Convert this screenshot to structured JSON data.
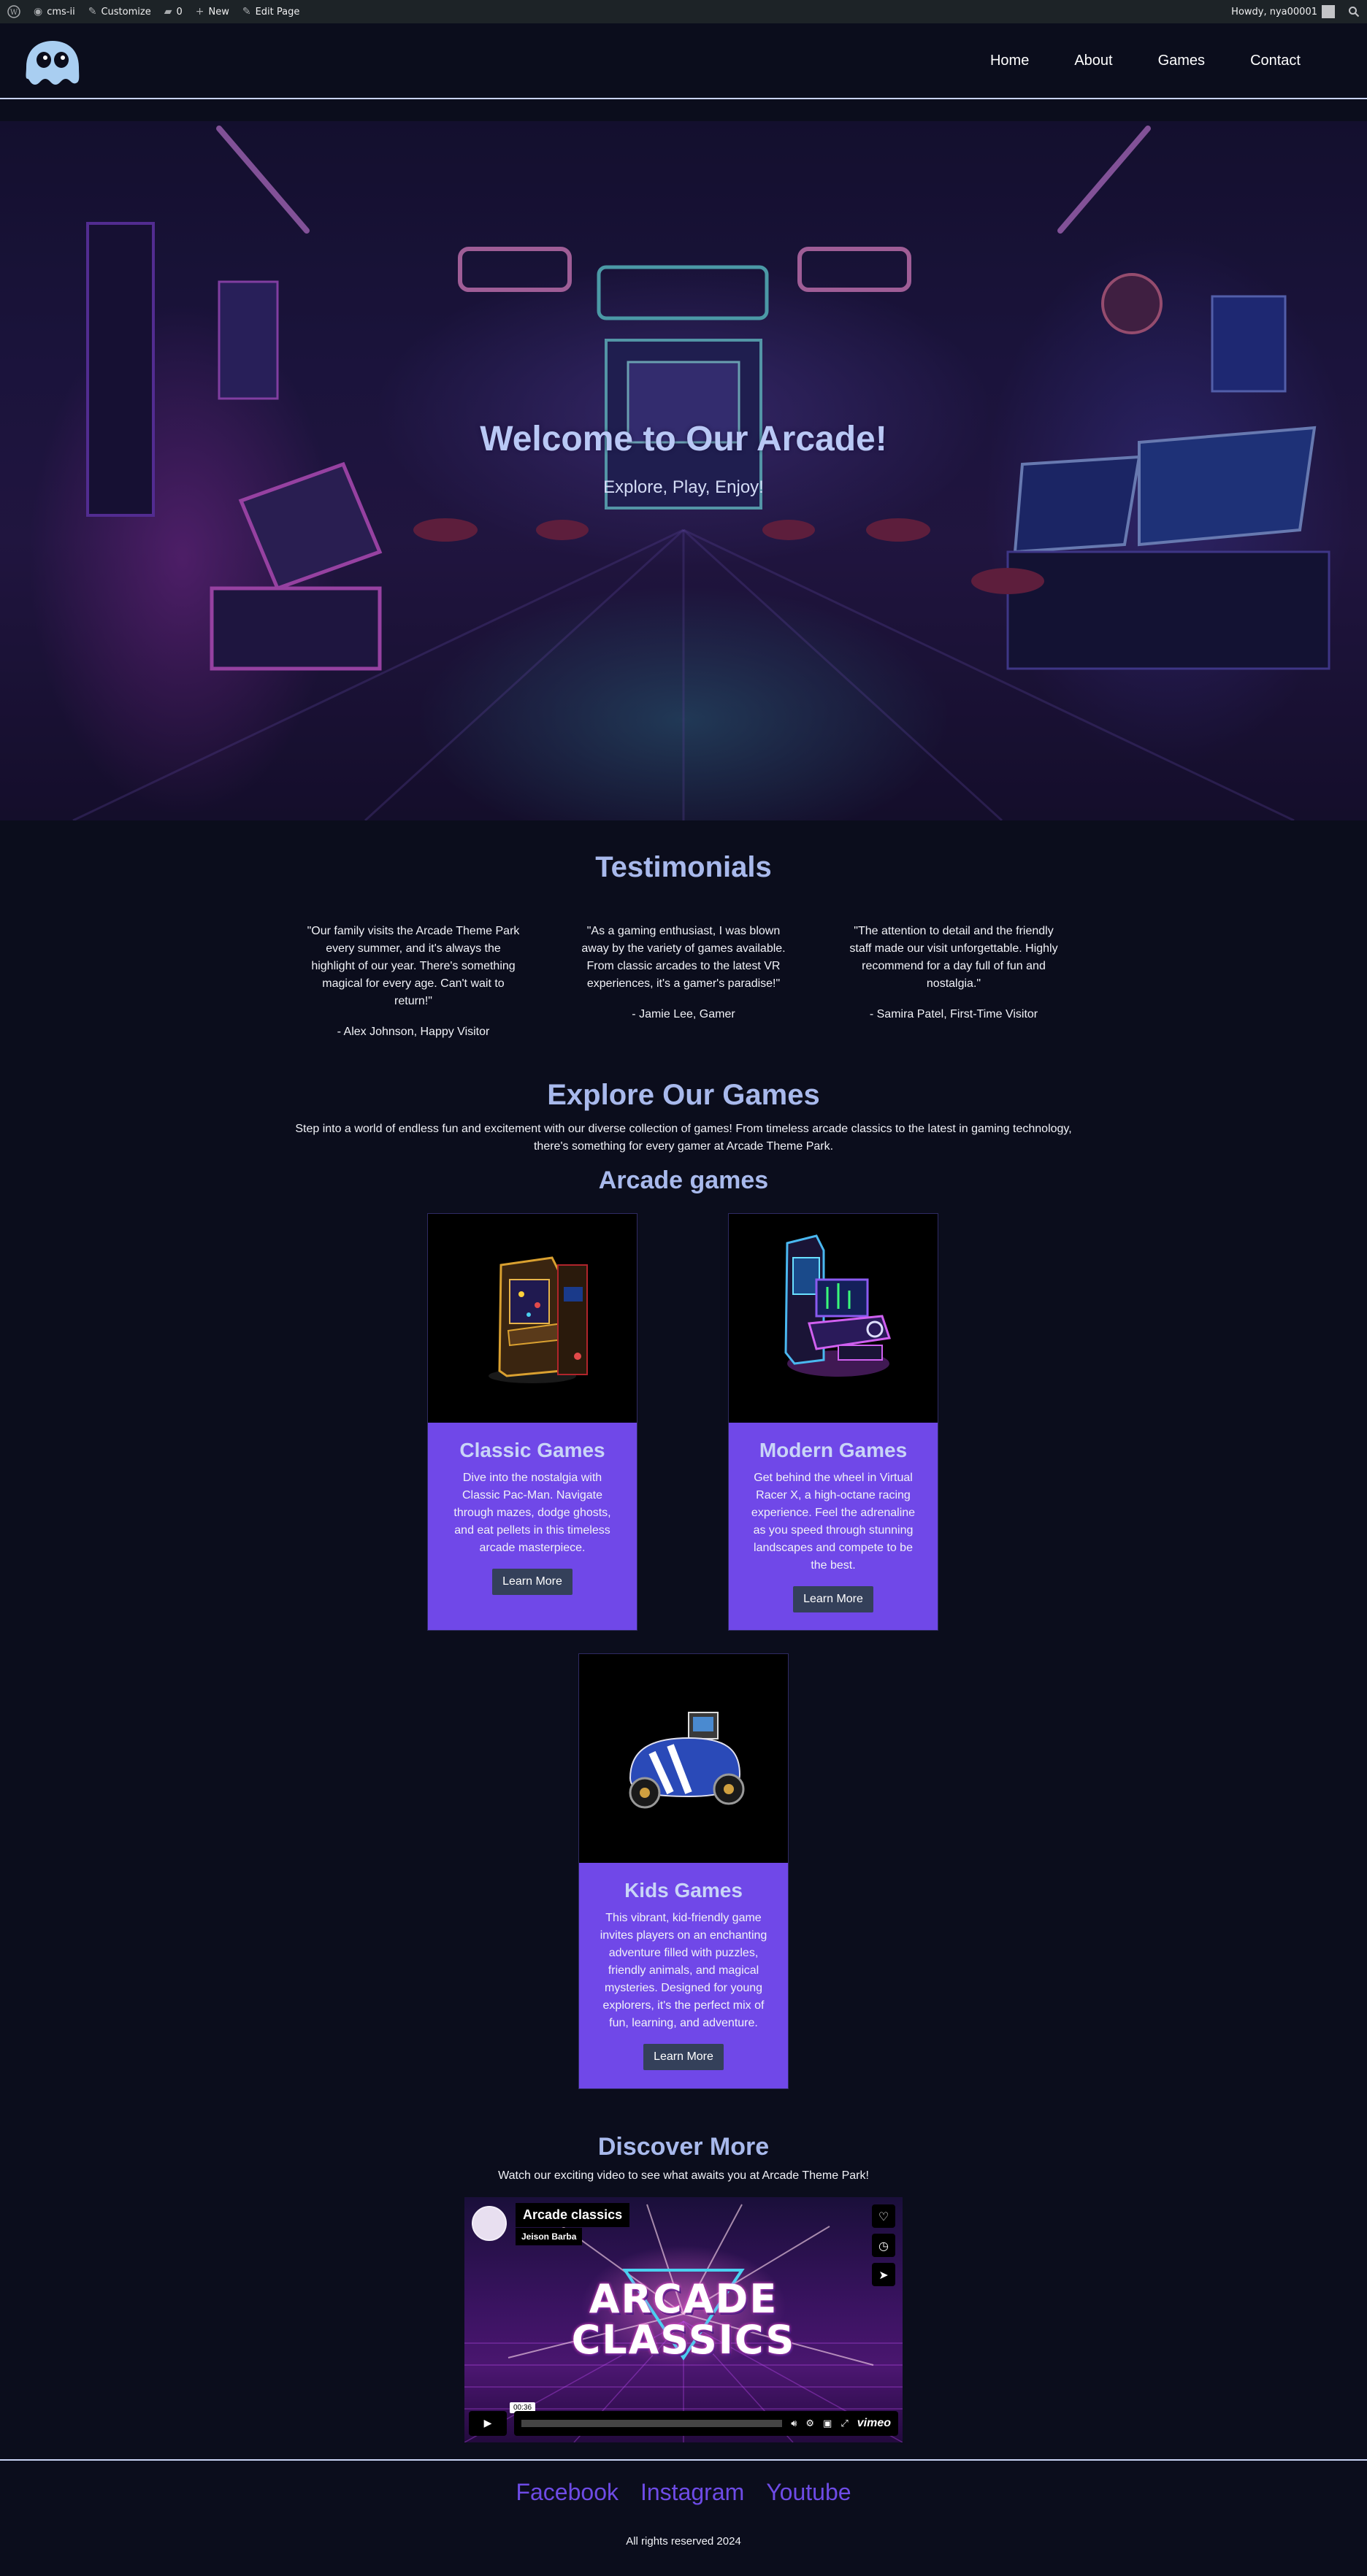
{
  "admin_bar": {
    "site": "cms-ii",
    "customize": "Customize",
    "comments": "0",
    "new": "New",
    "edit": "Edit Page",
    "howdy": "Howdy, nya00001"
  },
  "nav": {
    "items": [
      {
        "label": "Home"
      },
      {
        "label": "About"
      },
      {
        "label": "Games"
      },
      {
        "label": "Contact"
      }
    ]
  },
  "hero": {
    "title": "Welcome to Our Arcade!",
    "subtitle": "Explore, Play, Enjoy!"
  },
  "testimonials": {
    "title": "Testimonials",
    "items": [
      {
        "quote": "\"Our family visits the Arcade Theme Park every summer, and it's always the highlight of our year. There's something magical for every age. Can't wait to return!\"",
        "author": "- Alex Johnson, Happy Visitor"
      },
      {
        "quote": "\"As a gaming enthusiast, I was blown away by the variety of games available. From classic arcades to the latest VR experiences, it's a gamer's paradise!\"",
        "author": "- Jamie Lee, Gamer"
      },
      {
        "quote": "\"The attention to detail and the friendly staff made our visit unforgettable. Highly recommend for a day full of fun and nostalgia.\"",
        "author": "- Samira Patel, First-Time Visitor"
      }
    ]
  },
  "games": {
    "title": "Explore Our Games",
    "intro": "Step into a world of endless fun and excitement with our diverse collection of games! From timeless arcade classics to the latest in gaming technology, there's something for every gamer at Arcade Theme Park.",
    "subtitle": "Arcade games",
    "cards": [
      {
        "title": "Classic Games",
        "text": "Dive into the nostalgia with Classic Pac-Man. Navigate through mazes, dodge ghosts, and eat pellets in this timeless arcade masterpiece.",
        "button": "Learn More"
      },
      {
        "title": "Modern Games",
        "text": "Get behind the wheel in Virtual Racer X, a high-octane racing experience. Feel the adrenaline as you speed through stunning landscapes and compete to be the best.",
        "button": "Learn More"
      },
      {
        "title": "Kids Games",
        "text": "This vibrant, kid-friendly game invites players on an enchanting adventure filled with puzzles, friendly animals, and magical mysteries. Designed for young explorers, it's the perfect mix of fun, learning, and adventure.",
        "button": "Learn More"
      }
    ]
  },
  "discover": {
    "title": "Discover More",
    "text": "Watch our exciting video to see what awaits you at Arcade Theme Park!",
    "video": {
      "title": "Arcade classics",
      "author": "Jeison Barba",
      "time": "00:36",
      "brand": "vimeo",
      "art_line1": "ARCADE",
      "art_line2": "CLASSICS",
      "progress": 0.0
    }
  },
  "footer": {
    "social": [
      {
        "label": "Facebook"
      },
      {
        "label": "Instagram"
      },
      {
        "label": "Youtube"
      }
    ],
    "copyright": "All rights reserved 2024"
  },
  "colors": {
    "background": "#0b0d1c",
    "card": "#7048e8",
    "heading": "#a8b9ec",
    "social_link": "#6e4be6",
    "button": "#34405a"
  }
}
